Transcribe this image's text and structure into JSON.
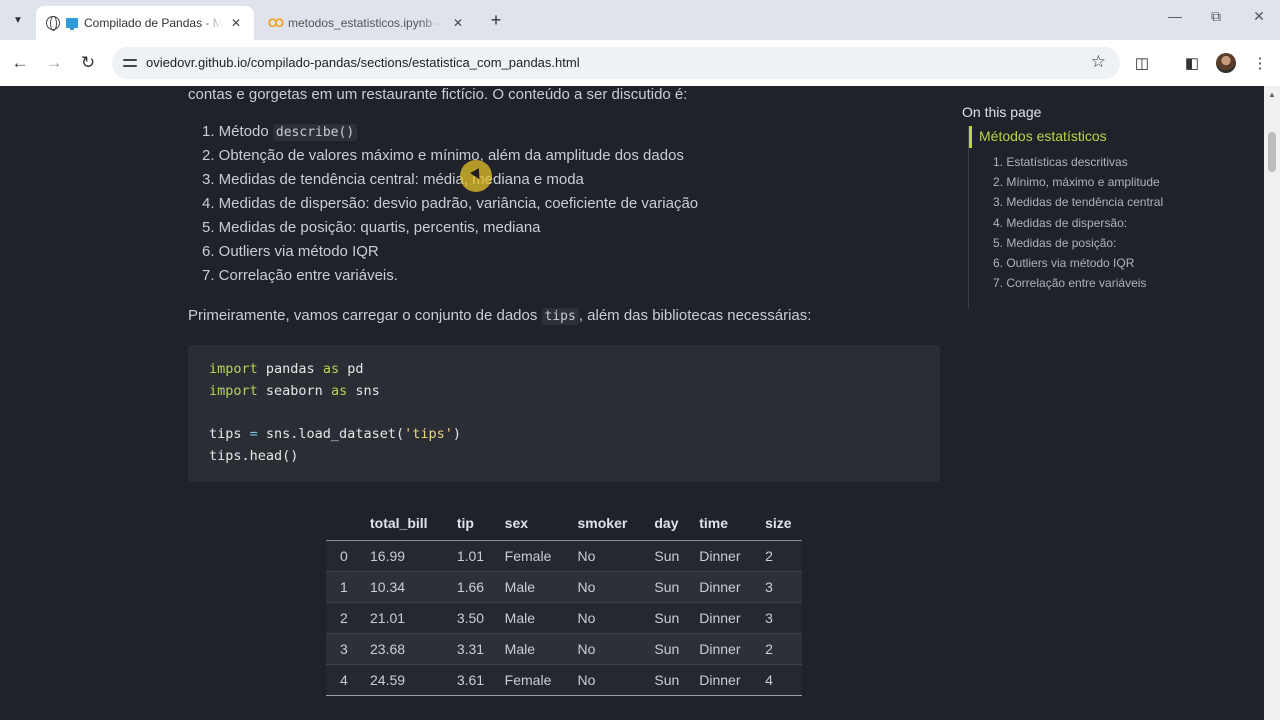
{
  "browser": {
    "tabs": [
      {
        "title": "Compilado de Pandas - Ma",
        "active": true
      },
      {
        "title": "metodos_estatisticos.ipynb - Co",
        "active": false
      }
    ],
    "url": "oviedovr.github.io/compilado-pandas/sections/estatistica_com_pandas.html",
    "icons": {
      "tab_search": "chevron-down-icon",
      "new_tab": "plus-icon",
      "back": "arrow-left-icon",
      "forward": "arrow-right-icon",
      "reload": "reload-icon",
      "site_info": "tune-icon",
      "bookmark": "star-icon",
      "extensions": "puzzle-icon",
      "side_panel": "side-panel-icon",
      "profile": "avatar",
      "menu": "kebab-menu-icon"
    }
  },
  "article": {
    "intro_line": "contas e gorgetas em um restaurante fictício. O conteúdo a ser discutido é:",
    "list": {
      "item1_prefix": "1. Método ",
      "item1_code": "describe()",
      "items": [
        "2. Obtenção de valores máximo e mínimo, além da amplitude dos dados",
        "3. Medidas de tendência central: média, mediana e moda",
        "4. Medidas de dispersão: desvio padrão, variância, coeficiente de variação",
        "5. Medidas de posição: quartis, percentis, mediana",
        "6. Outliers via método IQR",
        "7. Correlação entre variáveis."
      ]
    },
    "load_para": {
      "before": "Primeiramente, vamos carregar o conjunto de dados ",
      "code": "tips",
      "after": ", além das bibliotecas necessárias:"
    },
    "code": {
      "l1": {
        "kw1": "import",
        "mod": " pandas ",
        "kw2": "as",
        "alias": " pd"
      },
      "l2": {
        "kw1": "import",
        "mod": " seaborn ",
        "kw2": "as",
        "alias": " sns"
      },
      "l3": {
        "lhs": "tips ",
        "op": "=",
        "call": " sns.load_dataset(",
        "arg": "'tips'",
        "close": ")"
      },
      "l4": "tips.head()"
    },
    "dataframe": {
      "columns": [
        "",
        "total_bill",
        "tip",
        "sex",
        "smoker",
        "day",
        "time",
        "size"
      ],
      "rows": [
        [
          "0",
          "16.99",
          "1.01",
          "Female",
          "No",
          "Sun",
          "Dinner",
          "2"
        ],
        [
          "1",
          "10.34",
          "1.66",
          "Male",
          "No",
          "Sun",
          "Dinner",
          "3"
        ],
        [
          "2",
          "21.01",
          "3.50",
          "Male",
          "No",
          "Sun",
          "Dinner",
          "3"
        ],
        [
          "3",
          "23.68",
          "3.31",
          "Male",
          "No",
          "Sun",
          "Dinner",
          "2"
        ],
        [
          "4",
          "24.59",
          "3.61",
          "Female",
          "No",
          "Sun",
          "Dinner",
          "4"
        ]
      ]
    }
  },
  "toc": {
    "title": "On this page",
    "active": "Métodos estatísticos",
    "items": [
      "1. Estatísticas descritivas",
      "2. Mínimo, máximo e amplitude",
      "3. Medidas de tendência central",
      "4. Medidas de dispersão:",
      "5. Medidas de posição:",
      "6. Outliers via método IQR",
      "7. Correlação entre variáveis"
    ]
  },
  "colors": {
    "accent": "#b6d64a",
    "background": "#1f2228",
    "code_bg": "#2a2d34"
  }
}
